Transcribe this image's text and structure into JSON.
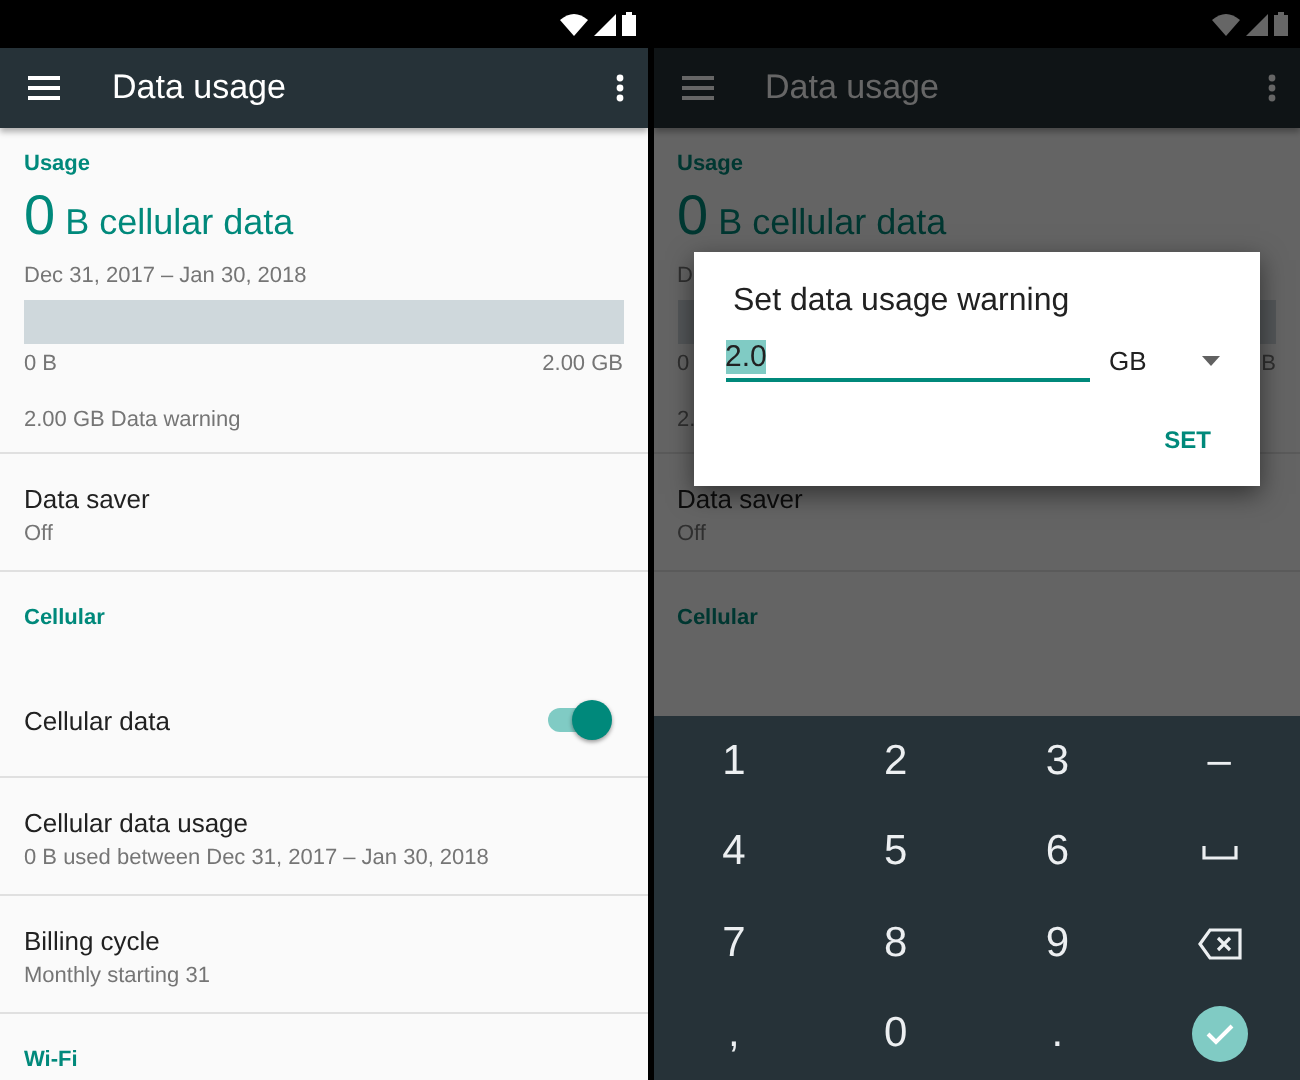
{
  "screens": [
    {
      "dimmed": false,
      "app_bar": {
        "title": "Data usage"
      },
      "usage": {
        "header": "Usage",
        "amount": "0",
        "unit": "B cellular data",
        "range": "Dec 31, 2017 – Jan 30, 2018",
        "bar_start": "0 B",
        "bar_end": "2.00 GB",
        "warning": "2.00 GB Data warning"
      },
      "items": [
        {
          "kind": "summary",
          "title": "Data saver",
          "summary": "Off"
        },
        {
          "kind": "category",
          "title": "Cellular"
        },
        {
          "kind": "toggle",
          "title": "Cellular data",
          "on": true
        },
        {
          "kind": "summary",
          "title": "Cellular data usage",
          "summary": "0 B used between Dec 31, 2017 – Jan 30, 2018"
        },
        {
          "kind": "summary",
          "title": "Billing cycle",
          "summary": "Monthly starting 31"
        },
        {
          "kind": "category",
          "title": "Wi-Fi"
        }
      ]
    },
    {
      "dimmed": true,
      "app_bar": {
        "title": "Data usage"
      },
      "usage": {
        "header": "Usage",
        "amount": "0",
        "unit": "B cellular data",
        "range": "D",
        "bar_start": "0",
        "bar_end": "B",
        "warning": "2."
      },
      "items": [
        {
          "kind": "summary",
          "title": "Data saver",
          "summary": "Off"
        },
        {
          "kind": "category",
          "title": "Cellular"
        }
      ],
      "dialog": {
        "title": "Set data usage warning",
        "value": "2.0",
        "unit": "GB",
        "button": "SET"
      },
      "keyboard": [
        {
          "kind": "char",
          "label": "1"
        },
        {
          "kind": "char",
          "label": "2"
        },
        {
          "kind": "char",
          "label": "3"
        },
        {
          "kind": "char",
          "label": "–"
        },
        {
          "kind": "char",
          "label": "4"
        },
        {
          "kind": "char",
          "label": "5"
        },
        {
          "kind": "char",
          "label": "6"
        },
        {
          "kind": "space"
        },
        {
          "kind": "char",
          "label": "7"
        },
        {
          "kind": "char",
          "label": "8"
        },
        {
          "kind": "char",
          "label": "9"
        },
        {
          "kind": "backspace"
        },
        {
          "kind": "char",
          "label": ","
        },
        {
          "kind": "char",
          "label": "0"
        },
        {
          "kind": "char",
          "label": "."
        },
        {
          "kind": "done"
        }
      ]
    }
  ]
}
